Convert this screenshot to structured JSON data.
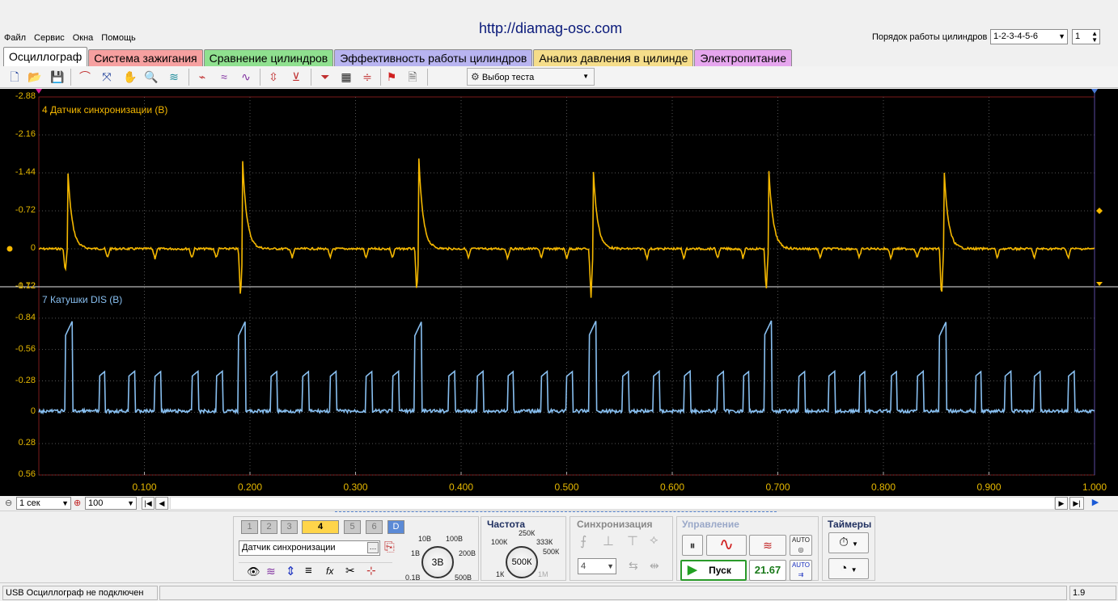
{
  "header": {
    "url": "http://diamag-osc.com",
    "menu": [
      "Файл",
      "Сервис",
      "Окна",
      "Помощь"
    ],
    "cyl_order_label": "Порядок работы цилиндров",
    "cyl_order_value": "1-2-3-4-5-6",
    "cyl_value": "1"
  },
  "tabs": [
    {
      "label": "Осциллограф",
      "color": "#ffffff"
    },
    {
      "label": "Система зажигания",
      "color": "#f6a0a0"
    },
    {
      "label": "Сравнение цилиндров",
      "color": "#8fe08f"
    },
    {
      "label": "Эффективность работы цилиндров",
      "color": "#b8b4f0"
    },
    {
      "label": "Анализ давления в цилинде",
      "color": "#f5dd8a"
    },
    {
      "label": "Электропитание",
      "color": "#e6a6ee"
    }
  ],
  "toolbar": {
    "test_select": "Выбор теста",
    "icons": [
      "new-file-icon",
      "open-folder-icon",
      "save-icon",
      "cursor-curve-icon",
      "measure-icon",
      "hand-pan-icon",
      "zoom-icon",
      "wave-filter-icon",
      "noise-icon",
      "sine-multi-icon",
      "sine-icon",
      "auto-scale-icon",
      "zero-icon",
      "filter-funnel-icon",
      "grid-icon",
      "cursor-lines-icon",
      "marker-flag-icon",
      "note-icon"
    ]
  },
  "scope": {
    "trace_top_label": "4 Датчик синхронизации (В)",
    "trace_bottom_label": "7 Катушки DIS (В)",
    "top_y_ticks": [
      "-2.88",
      "-2.16",
      "-1.44",
      "-0.72",
      "0",
      "0.72"
    ],
    "bottom_y_ticks": [
      "-1.12",
      "-0.84",
      "-0.56",
      "-0.28",
      "0",
      "0.28",
      "0.56"
    ],
    "x_ticks": [
      "0.100",
      "0.200",
      "0.300",
      "0.400",
      "0.500",
      "0.600",
      "0.700",
      "0.800",
      "0.900",
      "1.000"
    ],
    "colors": {
      "top": "#f5b800",
      "bottom": "#88bff0",
      "grid": "#555555",
      "bg": "#000000"
    }
  },
  "chart_data": {
    "type": "line",
    "title": "",
    "xlabel": "",
    "ylabel": "",
    "x_range": [
      0,
      1.0
    ],
    "series": [
      {
        "name": "4 Датчик синхронизации (В)",
        "ylim": [
          -2.88,
          0.72
        ],
        "spikes": [
          {
            "x": 0.027,
            "peak": -1.7,
            "dip": 0.45
          },
          {
            "x": 0.193,
            "peak": -1.7,
            "dip": 0.95
          },
          {
            "x": 0.36,
            "peak": -1.7,
            "dip": 0.85
          },
          {
            "x": 0.525,
            "peak": -1.6,
            "dip": 0.95
          },
          {
            "x": 0.691,
            "peak": -1.7,
            "dip": 0.85
          },
          {
            "x": 0.857,
            "peak": -1.7,
            "dip": 0.98
          }
        ],
        "small_dips": [
          0.065,
          0.11,
          0.145,
          0.168,
          0.24,
          0.276,
          0.31,
          0.335,
          0.407,
          0.444,
          0.476,
          0.5,
          0.576,
          0.611,
          0.643,
          0.667,
          0.74,
          0.777,
          0.807,
          0.832,
          0.908,
          0.943,
          0.975
        ]
      },
      {
        "name": "7 Катушки DIS (В)",
        "ylim": [
          -1.12,
          0.56
        ],
        "tall_pulses": [
          0.025,
          0.189,
          0.356,
          0.521,
          0.687,
          0.853
        ],
        "short_pulses": [
          0.057,
          0.085,
          0.11,
          0.145,
          0.168,
          0.22,
          0.25,
          0.276,
          0.31,
          0.335,
          0.388,
          0.415,
          0.444,
          0.476,
          0.5,
          0.553,
          0.582,
          0.611,
          0.643,
          0.667,
          0.72,
          0.748,
          0.777,
          0.807,
          0.832,
          0.887,
          0.915,
          0.943,
          0.975
        ]
      }
    ]
  },
  "timebase": {
    "value": "1 сек",
    "zoom": "100"
  },
  "channels": {
    "buttons": [
      "1",
      "2",
      "3",
      "4",
      "5",
      "6",
      "D"
    ],
    "active": "4",
    "name": "Датчик синхронизации"
  },
  "voltage": {
    "labels": [
      "10В",
      "100В",
      "1В",
      "200В",
      "0.1В",
      "500В"
    ],
    "value": "3В"
  },
  "frequency": {
    "title": "Частота",
    "labels": [
      "250К",
      "100К",
      "333К",
      "500К",
      "1К",
      "1М"
    ],
    "value": "500К"
  },
  "sync": {
    "title": "Синхронизация",
    "value": "4"
  },
  "control": {
    "title": "Управление",
    "start": "Пуск",
    "value": "21.67"
  },
  "timers": {
    "title": "Таймеры"
  },
  "status": {
    "text": "USB Осциллограф не подключен",
    "version": "1.9"
  }
}
